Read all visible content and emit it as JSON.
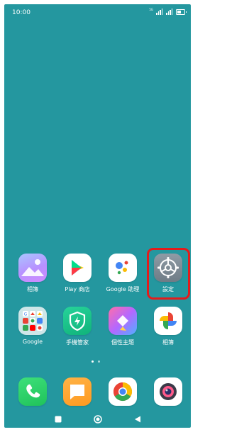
{
  "status_bar": {
    "time": "10:00",
    "network": "5G"
  },
  "home_rows": [
    [
      {
        "label": "相簿",
        "icon": "gallery-icon"
      },
      {
        "label": "Play 商店",
        "icon": "play-store-icon"
      },
      {
        "label": "Google 助理",
        "icon": "google-assistant-icon"
      },
      {
        "label": "設定",
        "icon": "settings-gear-icon",
        "highlighted": true
      }
    ],
    [
      {
        "label": "Google",
        "icon": "google-folder-icon"
      },
      {
        "label": "手機管家",
        "icon": "security-shield-icon"
      },
      {
        "label": "個性主題",
        "icon": "themes-icon"
      },
      {
        "label": "相簿",
        "icon": "google-photos-icon"
      }
    ]
  ],
  "page_indicator": {
    "pages": 2,
    "current": 1
  },
  "dock": [
    {
      "icon": "phone-icon"
    },
    {
      "icon": "messages-icon"
    },
    {
      "icon": "chrome-icon"
    },
    {
      "icon": "camera-icon"
    }
  ],
  "nav_bar": [
    "recents-square-icon",
    "home-circle-icon",
    "back-triangle-icon"
  ],
  "colors": {
    "wallpaper": "#24979f",
    "highlight": "#e21c1c"
  }
}
